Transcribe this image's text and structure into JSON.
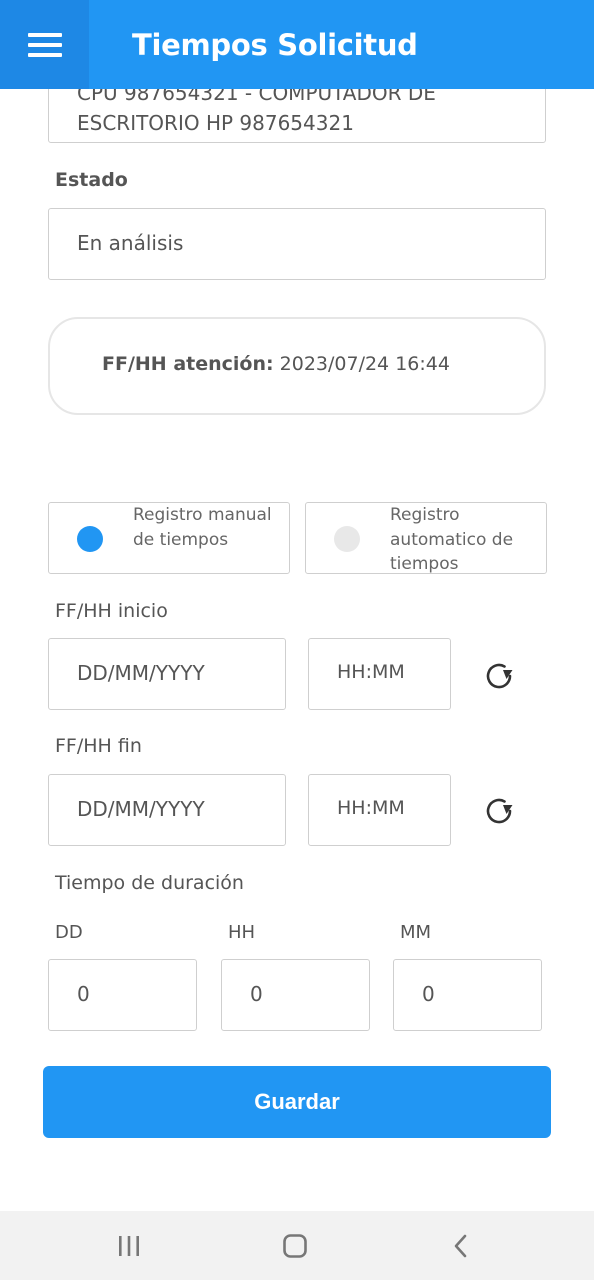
{
  "appbar": {
    "title": "Tiempos Solicitud",
    "menu_icon": "hamburger-menu-icon",
    "color": "#2196F3"
  },
  "equipo": {
    "value": "CPU 987654321 - COMPUTADOR DE ESCRITORIO HP 987654321"
  },
  "estado": {
    "label": "Estado",
    "value": "En análisis"
  },
  "atencion": {
    "label": "FF/HH atención:",
    "value": "2023/07/24 16:44"
  },
  "registro": {
    "options": [
      {
        "label": "Registro manual de tiempos",
        "selected": true
      },
      {
        "label": "Registro automatico de tiempos",
        "selected": false
      }
    ],
    "selected_color": "#2196F3",
    "unselected_color": "#e8e8e8"
  },
  "inicio": {
    "label": "FF/HH inicio",
    "date_placeholder": "DD/MM/YYYY",
    "time_placeholder": "HH:MM",
    "refresh_icon": "refresh-icon"
  },
  "fin": {
    "label": "FF/HH fin",
    "date_placeholder": "DD/MM/YYYY",
    "time_placeholder": "HH:MM",
    "refresh_icon": "refresh-icon"
  },
  "duracion": {
    "label": "Tiempo de duración",
    "fields": [
      {
        "label": "DD",
        "value": "0"
      },
      {
        "label": "HH",
        "value": "0"
      },
      {
        "label": "MM",
        "value": "0"
      }
    ]
  },
  "save_button": {
    "label": "Guardar"
  },
  "navbar": {
    "icons": [
      "recent-apps-icon",
      "home-icon",
      "back-icon"
    ]
  }
}
